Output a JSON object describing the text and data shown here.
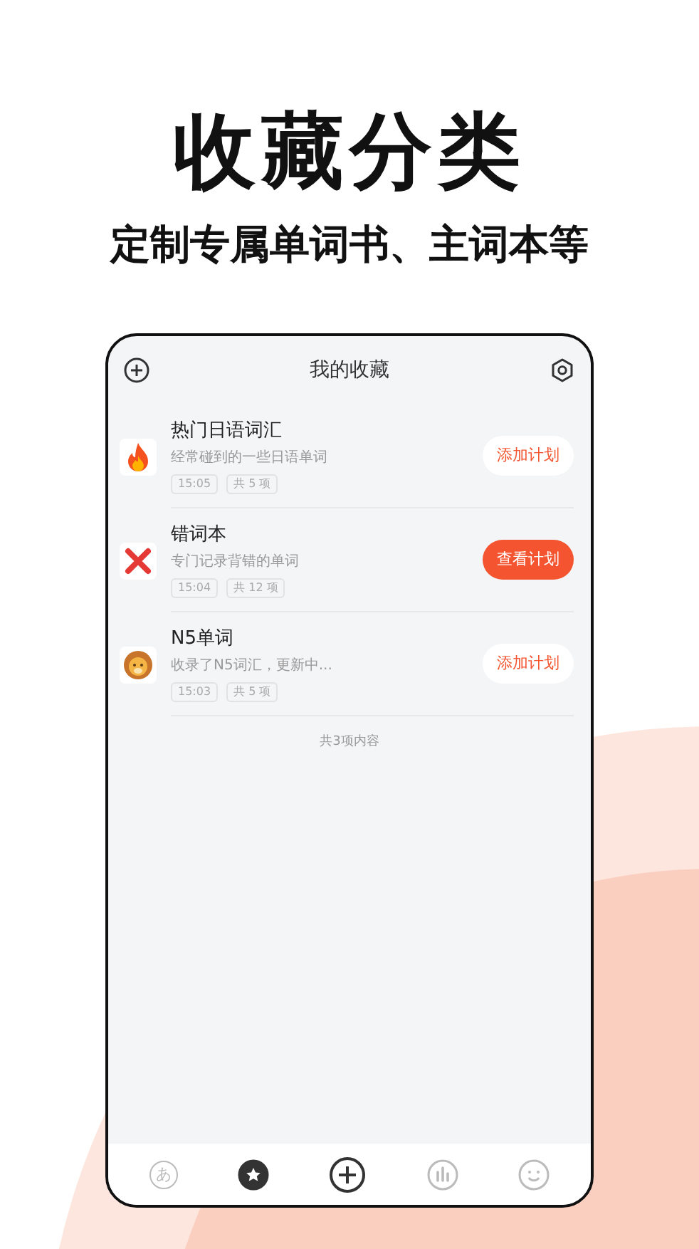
{
  "headline": "收藏分类",
  "subheadline": "定制专属单词书、主词本等",
  "screen": {
    "title": "我的收藏",
    "items": [
      {
        "name": "热门日语词汇",
        "description": "经常碰到的一些日语单词",
        "time": "15:05",
        "count": "共 5 项",
        "button": {
          "label": "添加计划",
          "filled": false
        }
      },
      {
        "name": "错词本",
        "description": "专门记录背错的单词",
        "time": "15:04",
        "count": "共 12 项",
        "button": {
          "label": "查看计划",
          "filled": true
        }
      },
      {
        "name": "N5单词",
        "description": "收录了N5词汇，更新中...",
        "time": "15:03",
        "count": "共 5 项",
        "button": {
          "label": "添加计划",
          "filled": false
        }
      }
    ],
    "footer": "共3项内容",
    "tabs": [
      {
        "kind": "kana",
        "label": "あ",
        "selected": false
      },
      {
        "kind": "star",
        "selected": true
      },
      {
        "kind": "add",
        "selected": false
      },
      {
        "kind": "stats",
        "selected": false
      },
      {
        "kind": "smile",
        "selected": false
      }
    ]
  }
}
